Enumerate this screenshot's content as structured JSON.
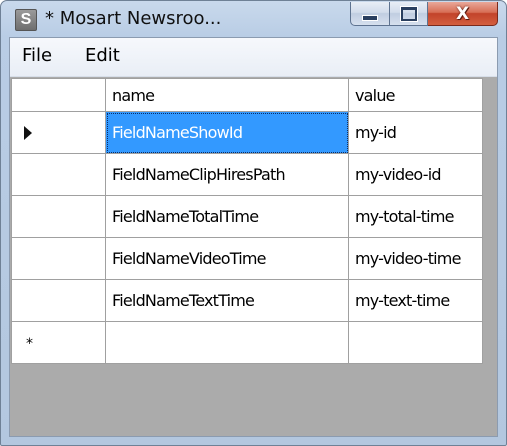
{
  "window": {
    "title": "* Mosart Newsroo...",
    "app_icon_letter": "S",
    "caption": {
      "close_glyph": "X"
    }
  },
  "menu": {
    "items": [
      {
        "label": "File"
      },
      {
        "label": "Edit"
      }
    ]
  },
  "grid": {
    "columns": [
      {
        "label": "name"
      },
      {
        "label": "value"
      }
    ],
    "rows": [
      {
        "name": "FieldNameShowId",
        "value": "my-id",
        "current": true,
        "selected_cell": "name"
      },
      {
        "name": "FieldNameClipHiresPath",
        "value": "my-video-id"
      },
      {
        "name": "FieldNameTotalTime",
        "value": "my-total-time"
      },
      {
        "name": "FieldNameVideoTime",
        "value": "my-video-time"
      },
      {
        "name": "FieldNameTextTime",
        "value": "my-text-time"
      }
    ],
    "new_row_marker": "*",
    "selection_color": "#3399ff"
  }
}
